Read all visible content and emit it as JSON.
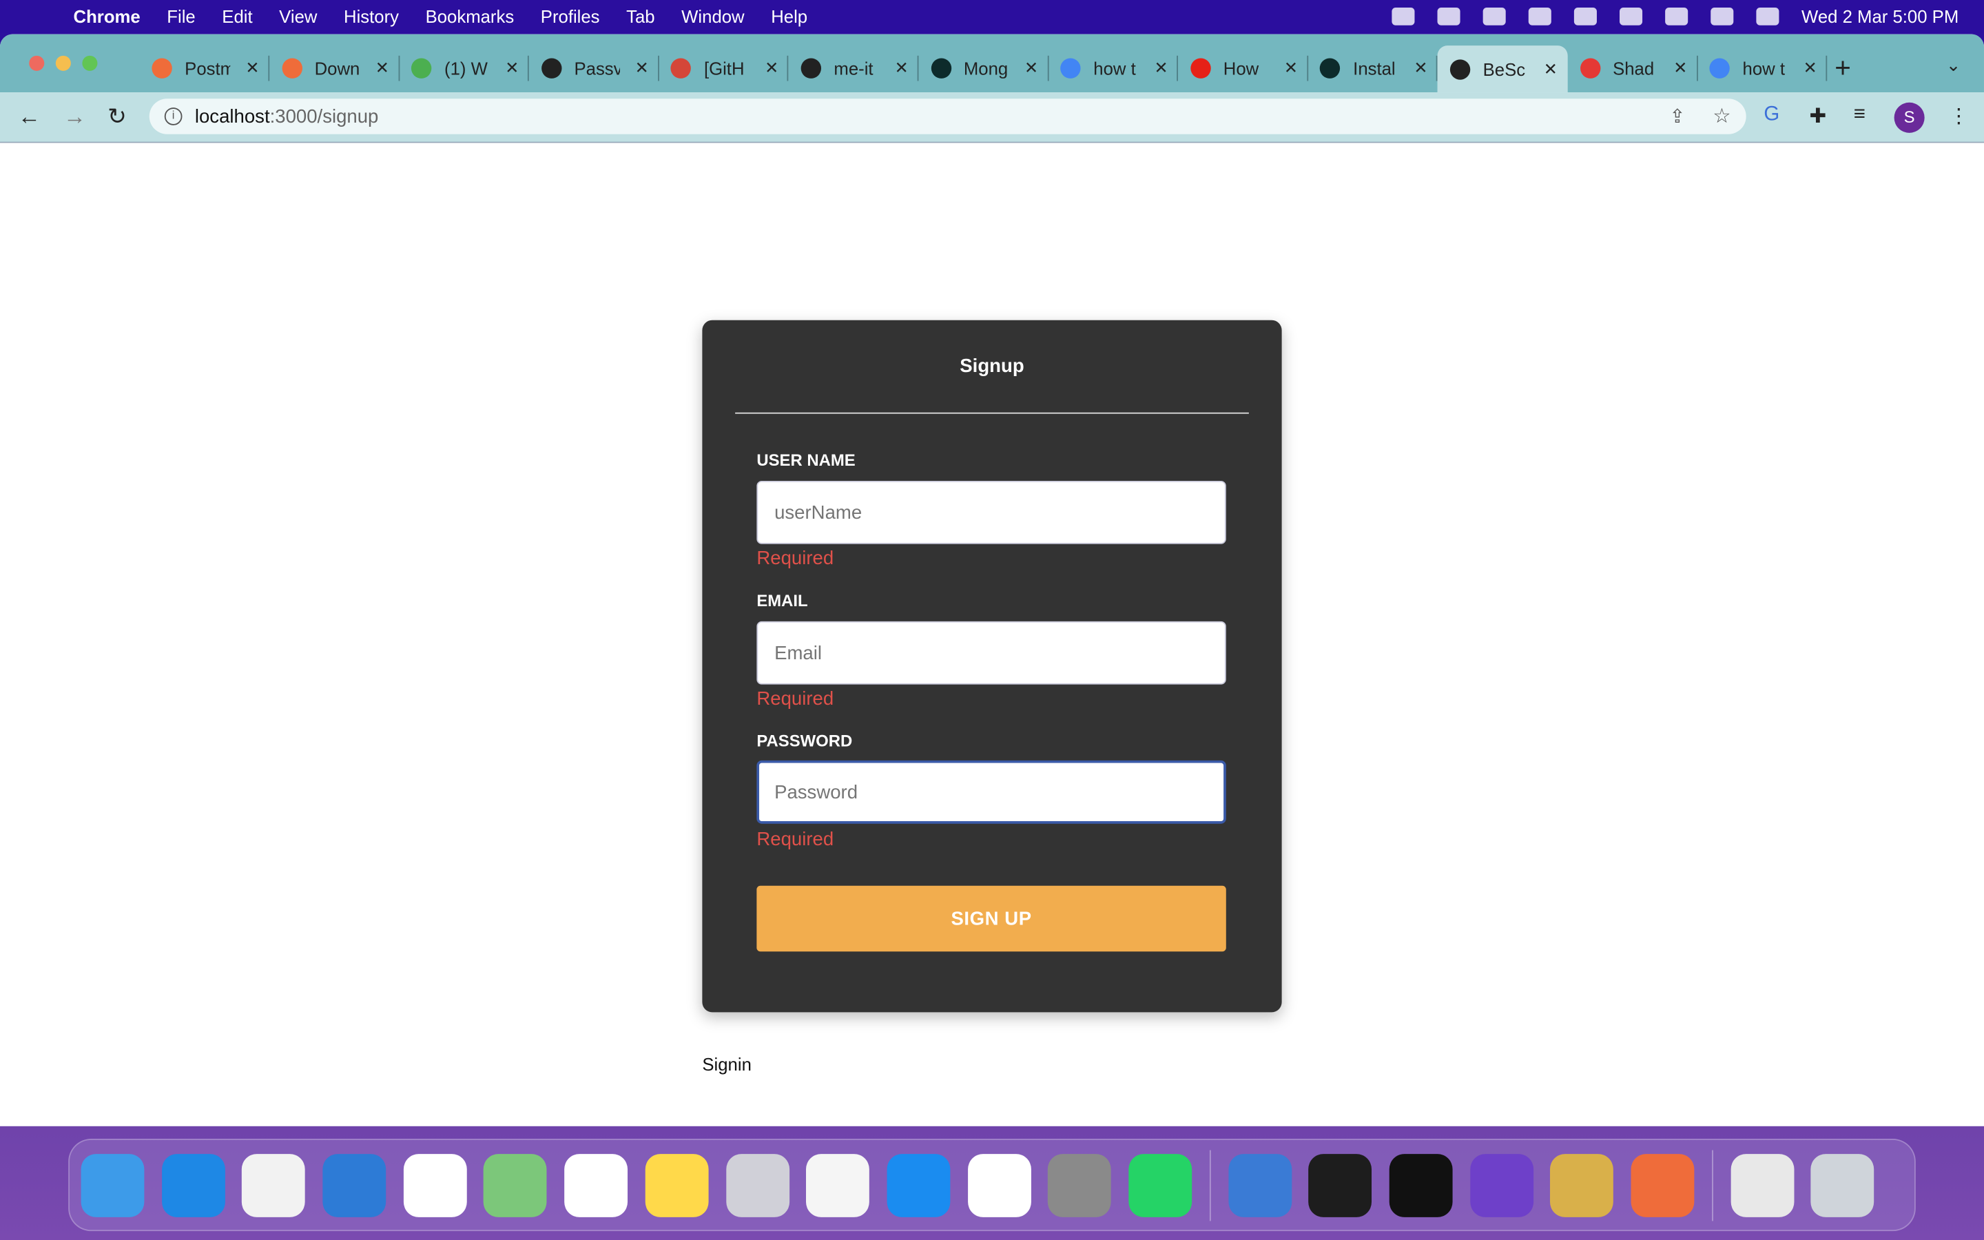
{
  "menubar": {
    "app": "Chrome",
    "items": [
      "File",
      "Edit",
      "View",
      "History",
      "Bookmarks",
      "Profiles",
      "Tab",
      "Window",
      "Help"
    ],
    "clock": "Wed 2 Mar  5:00 PM",
    "status_icons": [
      "onedrive-icon",
      "play-icon",
      "input-source-icon",
      "bluetooth-icon",
      "battery-icon",
      "wifi-icon",
      "spotlight-icon",
      "control-center-icon",
      "siri-icon"
    ]
  },
  "tabs": [
    {
      "title": "Postm",
      "color": "#ef6c3a"
    },
    {
      "title": "Down",
      "color": "#ef6c3a"
    },
    {
      "title": "(1) W",
      "color": "#4caf50"
    },
    {
      "title": "Passv",
      "color": "#222"
    },
    {
      "title": "[GitH",
      "color": "#d44638"
    },
    {
      "title": "me-it",
      "color": "#222"
    },
    {
      "title": "Mong",
      "color": "#0d2b2b"
    },
    {
      "title": "how t",
      "color": "#4285f4"
    },
    {
      "title": "How",
      "color": "#e62117"
    },
    {
      "title": "Instal",
      "color": "#0d2b2b"
    },
    {
      "title": "BeSc",
      "color": "#222",
      "active": true
    },
    {
      "title": "Shad",
      "color": "#e53935"
    },
    {
      "title": "how t",
      "color": "#4285f4"
    }
  ],
  "toolbar": {
    "url_host": "localhost",
    "url_path": ":3000/signup",
    "profile_initial": "S"
  },
  "form": {
    "title": "Signup",
    "fields": [
      {
        "label": "USER NAME",
        "placeholder": "userName",
        "error": "Required"
      },
      {
        "label": "EMAIL",
        "placeholder": "Email",
        "error": "Required"
      },
      {
        "label": "PASSWORD",
        "placeholder": "Password",
        "error": "Required"
      }
    ],
    "submit": "SIGN UP",
    "accent": "#f2ad4e",
    "error_color": "#e0514a"
  },
  "signin_link": "Signin",
  "dock": [
    {
      "name": "finder",
      "color": "#3d9be9"
    },
    {
      "name": "safari",
      "color": "#1e88e5"
    },
    {
      "name": "chrome",
      "color": "#f2f2f2"
    },
    {
      "name": "xcode",
      "color": "#2d7bd6"
    },
    {
      "name": "vscode",
      "color": "#ffffff"
    },
    {
      "name": "maps",
      "color": "#7cc77a"
    },
    {
      "name": "photos",
      "color": "#ffffff"
    },
    {
      "name": "notes",
      "color": "#ffd94a"
    },
    {
      "name": "launchpad",
      "color": "#d0d0d8"
    },
    {
      "name": "pages",
      "color": "#f5f5f5"
    },
    {
      "name": "app-store",
      "color": "#1a8cf0"
    },
    {
      "name": "onedrive",
      "color": "#ffffff"
    },
    {
      "name": "system-preferences",
      "color": "#8a8a8a"
    },
    {
      "name": "whatsapp",
      "color": "#25d366"
    },
    {
      "name": "simulator",
      "color": "#3a7bd5",
      "sep": true
    },
    {
      "name": "terminal",
      "color": "#1d1d1d"
    },
    {
      "name": "iterm",
      "color": "#111111"
    },
    {
      "name": "github-desktop",
      "color": "#6e40c9"
    },
    {
      "name": "archive-utility",
      "color": "#d9b04a"
    },
    {
      "name": "postman",
      "color": "#ef6c3a"
    },
    {
      "name": "downloads-stack",
      "color": "#e8e8e8",
      "sep": true
    },
    {
      "name": "trash",
      "color": "#cfd4da"
    }
  ]
}
